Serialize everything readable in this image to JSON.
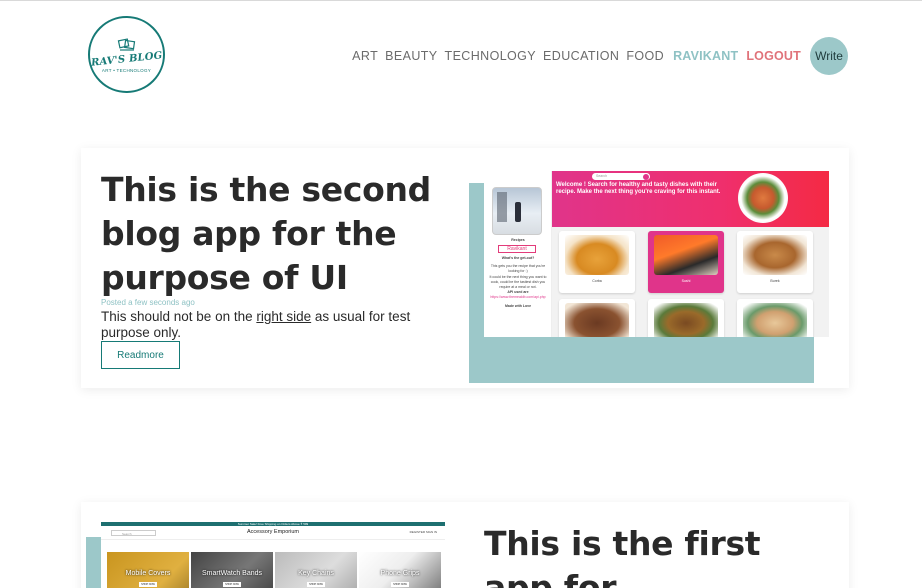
{
  "header": {
    "logo": {
      "title": "RAV'S BLOG",
      "subtitle": "ART • TECHNOLOGY"
    },
    "nav": [
      {
        "label": "ART"
      },
      {
        "label": "BEAUTY"
      },
      {
        "label": "TECHNOLOGY"
      },
      {
        "label": "EDUCATION"
      },
      {
        "label": "FOOD"
      }
    ],
    "user_label": "RAVIKANT",
    "logout_label": "LOGOUT",
    "write_label": "Write"
  },
  "posts": [
    {
      "title": "This is the second blog app for the purpose of UI",
      "posted": "Posted a few seconds ago",
      "desc_before": "This should not be on the ",
      "desc_link": "right side",
      "desc_after": " as usual for test purpose only.",
      "readmore_label": "Readmore",
      "screenshot": {
        "search_placeholder": "Search",
        "welcome_text": "Welcome ! Search for healthy and tasty dishes with their recipe. Make the next thing you're craving for this instant.",
        "sidebar_heading": "Recipes",
        "sidebar_name": "Ravikant",
        "sidebar_q": "What's the get-out?",
        "sidebar_line1": "This gets you the recipe that you're looking for :)",
        "sidebar_line2": "It could be the next thing you want to cook, could be the tastiest dish you require at a meal or not.",
        "sidebar_api": "API used are",
        "sidebar_api_link": "https://www.themealdb.com/api.php",
        "sidebar_made": "Made with Love",
        "tiles": [
          {
            "label": "Corba"
          },
          {
            "label": "Sushi"
          },
          {
            "label": "Burek"
          }
        ]
      }
    },
    {
      "title": "This is the first app for",
      "screenshot": {
        "top_strip": "Summer Sale! Free Shipping on Orders Above ₹ 599",
        "brand": "Accessory Emporium",
        "search_placeholder": "Search",
        "links": "REGISTER  SIGN IN",
        "tiles": [
          {
            "label": "Mobile Covers",
            "btn": "SHOP NOW"
          },
          {
            "label": "SmartWatch Bands",
            "btn": "SHOP NOW"
          },
          {
            "label": "Key Chains",
            "btn": "SHOP NOW"
          },
          {
            "label": "Phone Grips",
            "btn": "SHOP NOW"
          }
        ]
      }
    }
  ],
  "colors": {
    "brand_teal": "#167a76",
    "accent_teal": "#9cc8c9",
    "user_teal": "#8fc2c4",
    "logout_red": "#e0737a",
    "hero_pink": "#e0348a"
  }
}
